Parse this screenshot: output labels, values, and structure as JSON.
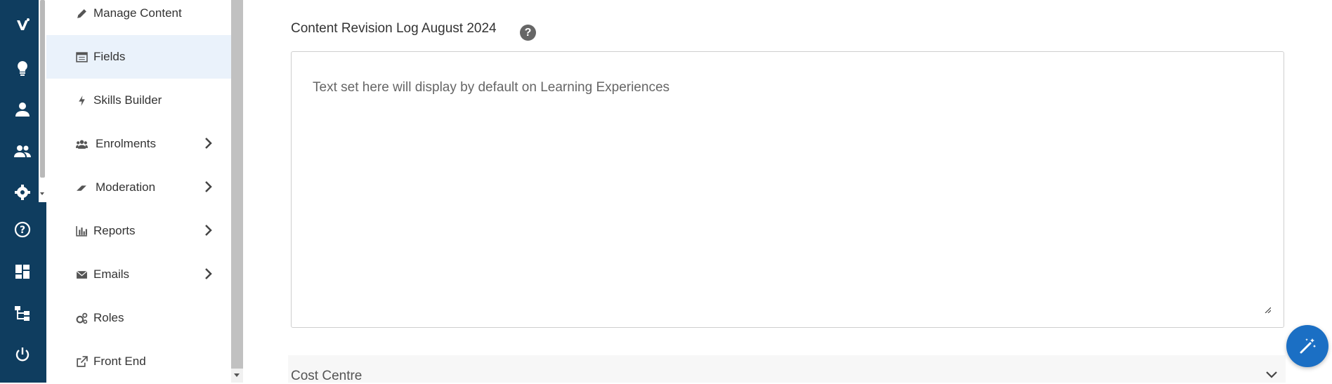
{
  "rail": {
    "icons": [
      "logo-icon",
      "lightbulb-icon",
      "user-icon",
      "users-icon",
      "gear-icon",
      "help-icon",
      "dashboard-icon",
      "hierarchy-icon",
      "power-icon"
    ]
  },
  "nav": {
    "items": [
      {
        "label": "Manage Content",
        "icon": "pencil-icon"
      },
      {
        "label": "Fields",
        "icon": "list-icon",
        "active": true
      },
      {
        "label": "Skills Builder",
        "icon": "bolt-icon"
      },
      {
        "label": "Enrolments",
        "icon": "group-icon",
        "expandable": true
      },
      {
        "label": "Moderation",
        "icon": "eraser-icon",
        "expandable": true
      },
      {
        "label": "Reports",
        "icon": "bar-chart-icon",
        "expandable": true
      },
      {
        "label": "Emails",
        "icon": "envelope-icon",
        "expandable": true
      },
      {
        "label": "Roles",
        "icon": "cogs-icon"
      },
      {
        "label": "Front End",
        "icon": "external-link-icon"
      }
    ]
  },
  "main": {
    "field_label": "Content Revision Log August 2024",
    "help": "?",
    "textarea_placeholder": "Text set here will display by default on Learning Experiences",
    "collapse_title": "Cost Centre"
  },
  "colors": {
    "rail": "#0f3d5f",
    "active": "#eaf2fb",
    "fab": "#1b6fc4"
  }
}
